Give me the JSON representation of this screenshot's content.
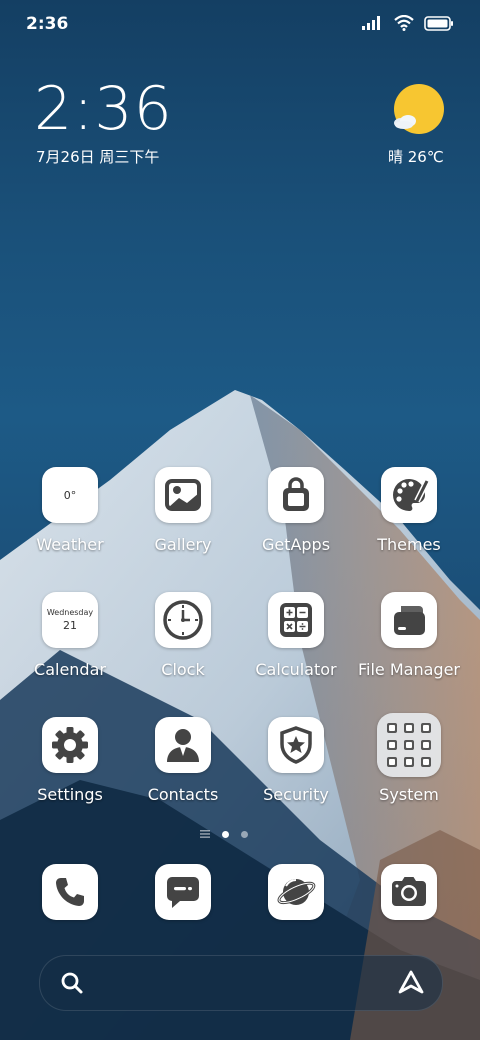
{
  "status_bar": {
    "time": "2:36"
  },
  "clock_widget": {
    "time": "2:36",
    "date": "7月26日 周三下午"
  },
  "weather_widget": {
    "text": "晴 26℃"
  },
  "apps": [
    {
      "label": "Weather",
      "icon": "weather-icon",
      "icon_text": "0°"
    },
    {
      "label": "Gallery",
      "icon": "gallery-icon"
    },
    {
      "label": "GetApps",
      "icon": "shopping-bag-icon"
    },
    {
      "label": "Themes",
      "icon": "palette-icon"
    },
    {
      "label": "Calendar",
      "icon": "calendar-icon",
      "icon_day": "Wednesday",
      "icon_date": "21"
    },
    {
      "label": "Clock",
      "icon": "clock-icon"
    },
    {
      "label": "Calculator",
      "icon": "calculator-icon"
    },
    {
      "label": "File Manager",
      "icon": "folder-icon"
    },
    {
      "label": "Settings",
      "icon": "gear-icon"
    },
    {
      "label": "Contacts",
      "icon": "person-icon"
    },
    {
      "label": "Security",
      "icon": "shield-icon"
    },
    {
      "label": "System",
      "icon": "folder-grid-icon"
    }
  ],
  "page_indicator": {
    "total_pages": 2,
    "current_page": 1
  },
  "dock": [
    {
      "icon": "phone-icon"
    },
    {
      "icon": "messages-icon"
    },
    {
      "icon": "browser-icon"
    },
    {
      "icon": "camera-icon"
    }
  ],
  "search_bar": {
    "icon": "search-icon",
    "assistant_icon": "assistant-icon"
  },
  "colors": {
    "icon_glyph": "#444444",
    "sun": "#f7c631",
    "icon_bg": "#ffffff"
  }
}
